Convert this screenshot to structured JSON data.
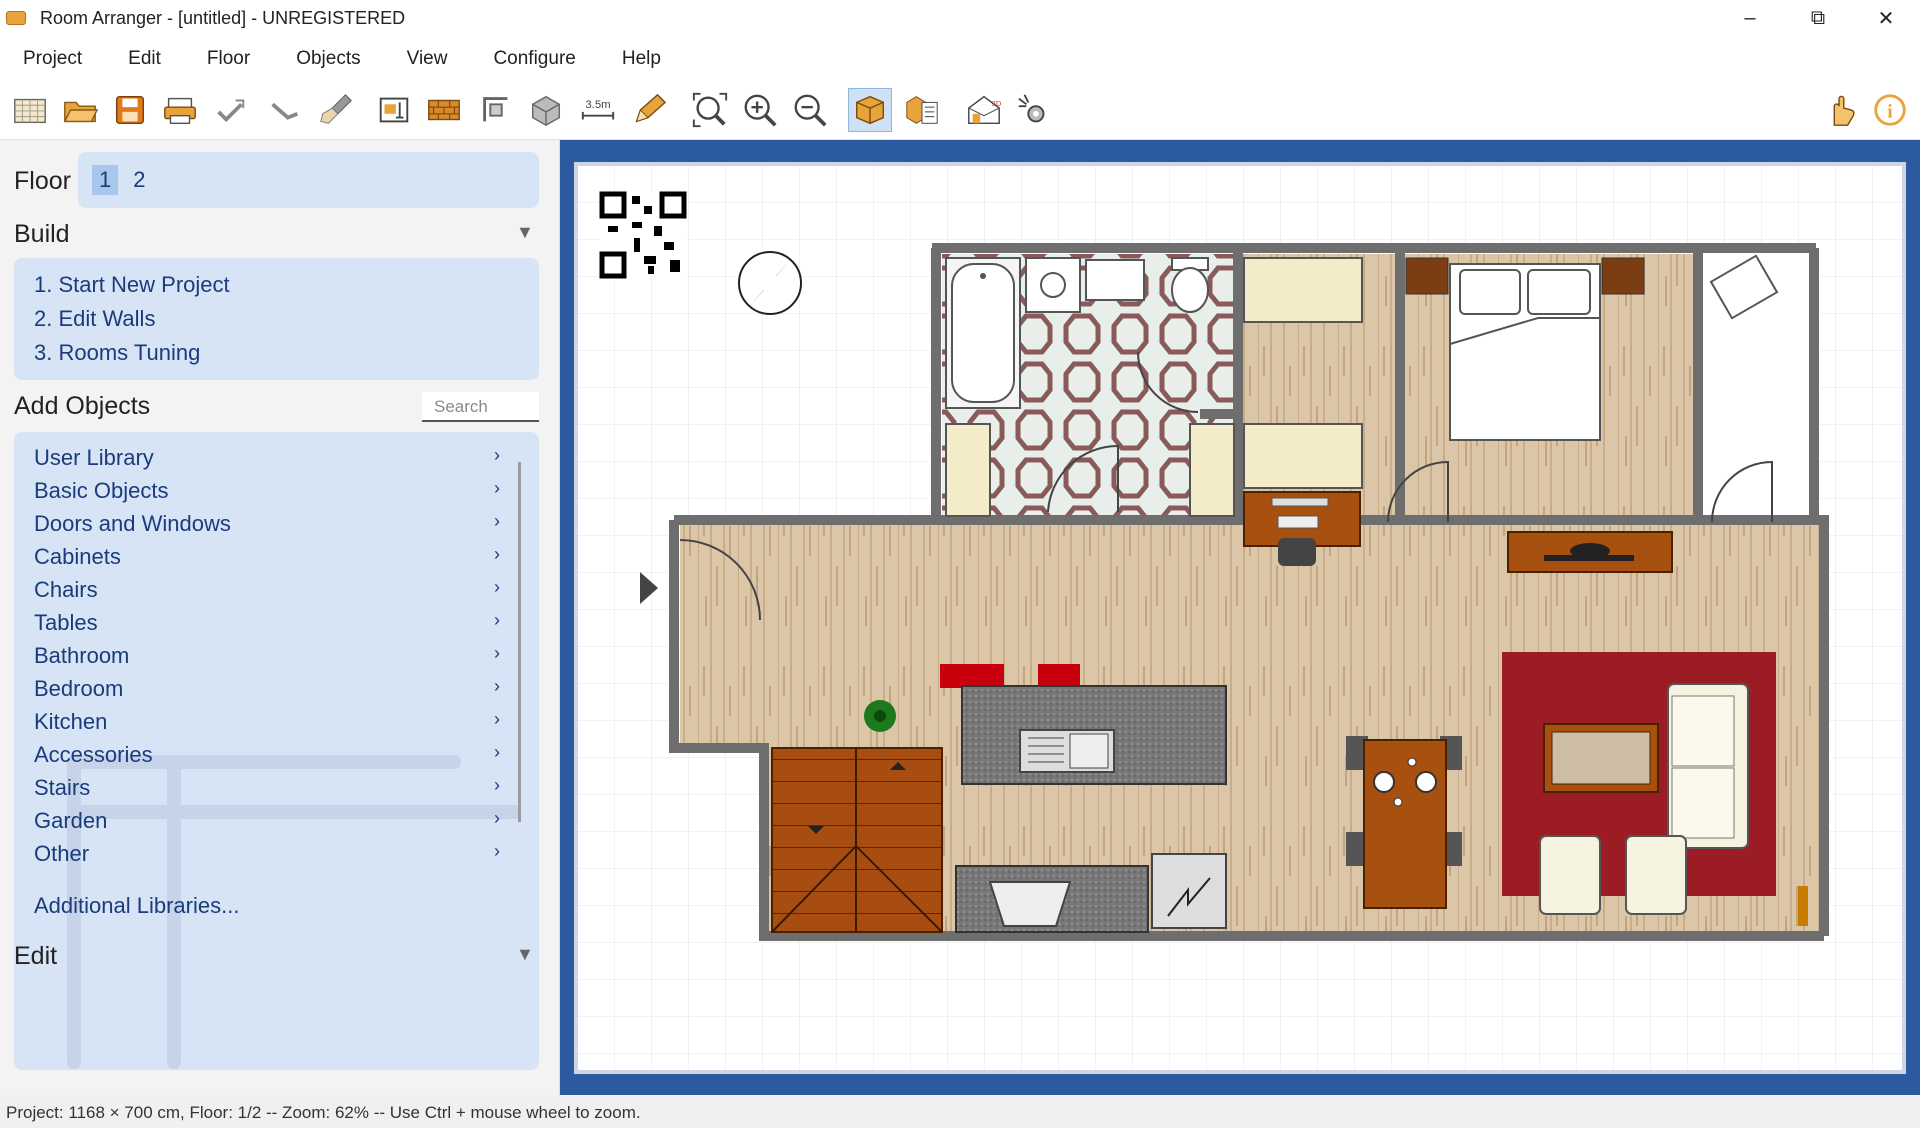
{
  "window": {
    "title": "Room Arranger - [untitled] - UNREGISTERED"
  },
  "menu": [
    "Project",
    "Edit",
    "Floor",
    "Objects",
    "View",
    "Configure",
    "Help"
  ],
  "toolbar": {
    "dimension_label": "3.5m",
    "icons": [
      "new-plan-icon",
      "open-icon",
      "save-icon",
      "print-icon",
      "undo-icon",
      "redo-icon",
      "paint-brush-icon",
      "room-properties-icon",
      "wall-icon",
      "resize-icon",
      "3d-box-icon",
      "dimension-icon",
      "pencil-icon",
      "zoom-fit-icon",
      "zoom-in-icon",
      "zoom-out-icon",
      "2d-view-icon",
      "objects-list-icon",
      "3d-view-icon",
      "settings-gear-icon",
      "hand-icon",
      "info-icon"
    ]
  },
  "panel": {
    "floor_label": "Floor",
    "floors": [
      "1",
      "2"
    ],
    "build_label": "Build",
    "build_steps": [
      "1. Start New Project",
      "2. Edit Walls",
      "3. Rooms Tuning"
    ],
    "add_objects_label": "Add Objects",
    "search_placeholder": "Search",
    "categories": [
      "User Library",
      "Basic Objects",
      "Doors and Windows",
      "Cabinets",
      "Chairs",
      "Tables",
      "Bathroom",
      "Bedroom",
      "Kitchen",
      "Accessories",
      "Stairs",
      "Garden",
      "Other"
    ],
    "additional_libraries": "Additional Libraries...",
    "edit_label": "Edit"
  },
  "status": {
    "text": "Project: 1168 × 700 cm, Floor: 1/2 -- Zoom: 62% -- Use Ctrl + mouse wheel to zoom."
  },
  "colors": {
    "canvas_bg": "#2b5a9e",
    "panel_blue": "#d7e4f6",
    "link_blue": "#1a3c7a",
    "wood": "#d9c2a4",
    "rug": "#a01a22"
  }
}
